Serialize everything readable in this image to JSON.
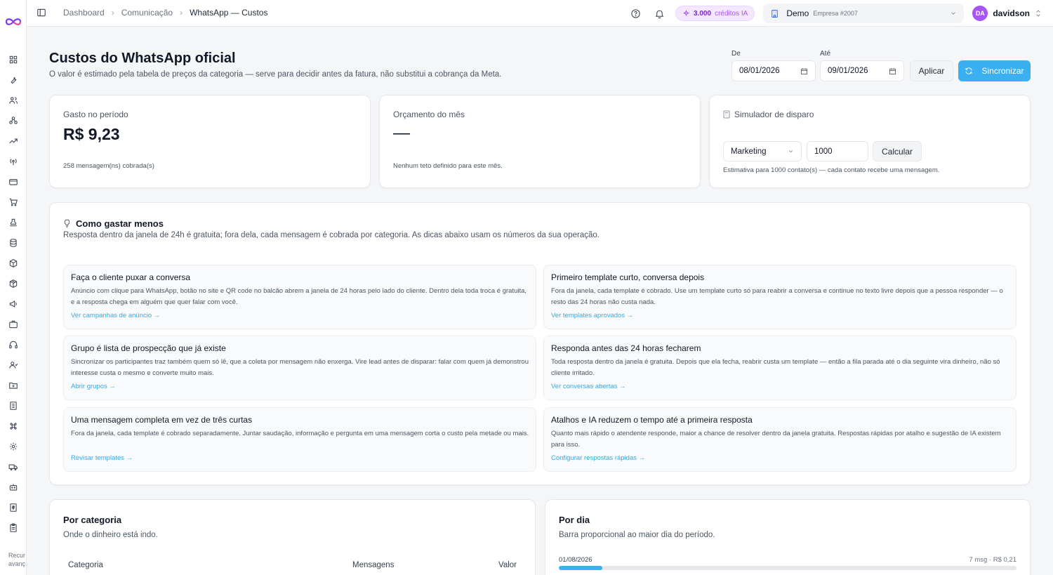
{
  "app": {
    "colors": {
      "accent": "#3ab0f0",
      "purple": "#a855f7",
      "page_bg": "#f5f6f8"
    }
  },
  "sidebar": {
    "icons": [
      "grid-icon",
      "wrench-icon",
      "users-icon",
      "share-icon",
      "trend-icon",
      "broadcast-icon",
      "card-icon",
      "cart-icon",
      "stamp-icon",
      "database-icon",
      "box-icon",
      "package-icon",
      "megaphone-icon",
      "briefcase-icon",
      "headset-icon",
      "contacts-icon",
      "folder-icon",
      "building-icon",
      "command-icon",
      "gear-icon",
      "truck-icon",
      "bot-icon",
      "sheet-icon",
      "clipboard-icon"
    ],
    "footer_line1": "Recur",
    "footer_line2": "avanç"
  },
  "topbar": {
    "breadcrumb": [
      "Dashboard",
      "Comunicação",
      "WhatsApp — Custos"
    ],
    "credits_value": "3.000",
    "credits_label": "créditos IA",
    "org_name": "Demo",
    "org_sub": "Empresa #2007",
    "user_initials": "DA",
    "user_name": "davidson"
  },
  "header": {
    "title": "Custos do WhatsApp oficial",
    "subtitle": "O valor é estimado pela tabela de preços da categoria — serve para decidir antes da fatura, não substitui a cobrança da Meta.",
    "from_label": "De",
    "from_value": "08/01/2026",
    "to_label": "Até",
    "to_value": "09/01/2026",
    "apply_label": "Aplicar",
    "sync_label": "Sincronizar"
  },
  "stats": {
    "spent_title": "Gasto no período",
    "spent_value": "R$ 9,23",
    "spent_note": "258 mensagem(ns) cobrada(s)",
    "budget_title": "Orçamento do mês",
    "budget_value": "—",
    "budget_note": "Nenhum teto definido para este mês."
  },
  "simulator": {
    "title": "Simulador de disparo",
    "category": "Marketing",
    "contacts": "1000",
    "calc_label": "Calcular",
    "note": "Estimativa para 1000 contato(s) — cada contato recebe uma mensagem."
  },
  "tips": {
    "title": "Como gastar menos",
    "subtitle": "Resposta dentro da janela de 24h é gratuita; fora dela, cada mensagem é cobrada por categoria. As dicas abaixo usam os números da sua operação.",
    "items": [
      {
        "title": "Faça o cliente puxar a conversa",
        "desc": "Anúncio com clique para WhatsApp, botão no site e QR code no balcão abrem a janela de 24 horas pelo lado do cliente. Dentro dela toda troca é gratuita, e a resposta chega em alguém que quer falar com você.",
        "link": "Ver campanhas de anúncio →"
      },
      {
        "title": "Primeiro template curto, conversa depois",
        "desc": "Fora da janela, cada template é cobrado. Use um template curto só para reabrir a conversa e continue no texto livre depois que a pessoa responder — o resto das 24 horas não custa nada.",
        "link": "Ver templates aprovados →"
      },
      {
        "title": "Grupo é lista de prospecção que já existe",
        "desc": "Sincronizar os participantes traz também quem só lê, que a coleta por mensagem não enxerga. Vire lead antes de disparar: falar com quem já demonstrou interesse custa o mesmo e converte muito mais.",
        "link": "Abrir grupos →"
      },
      {
        "title": "Responda antes das 24 horas fecharem",
        "desc": "Toda resposta dentro da janela é gratuita. Depois que ela fecha, reabrir custa um template — então a fila parada até o dia seguinte vira dinheiro, não só cliente irritado.",
        "link": "Ver conversas abertas →"
      },
      {
        "title": "Uma mensagem completa em vez de três curtas",
        "desc": "Fora da janela, cada template é cobrado separadamente. Juntar saudação, informação e pergunta em uma mensagem corta o custo pela metade ou mais.",
        "link": "Revisar templates →"
      },
      {
        "title": "Atalhos e IA reduzem o tempo até a primeira resposta",
        "desc": "Quanto mais rápido o atendente responde, maior a chance de resolver dentro da janela gratuita. Respostas rápidas por atalho e sugestão de IA existem para isso.",
        "link": "Configurar respostas rápidas →"
      }
    ]
  },
  "by_category": {
    "title": "Por categoria",
    "subtitle": "Onde o dinheiro está indo.",
    "columns": [
      "Categoria",
      "Mensagens",
      "Valor"
    ]
  },
  "by_day": {
    "title": "Por dia",
    "subtitle": "Barra proporcional ao maior dia do período.",
    "rows": [
      {
        "date": "01/08/2026",
        "meta": "7 msg · R$ 0,21",
        "fraction": 0.095
      }
    ]
  }
}
